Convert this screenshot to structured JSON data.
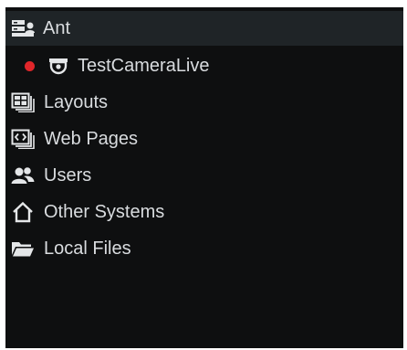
{
  "tree": {
    "server": {
      "label": "Ant",
      "icon": "server-icon"
    },
    "camera": {
      "label": "TestCameraLive",
      "icon": "camera-icon",
      "status_color": "#e0262a"
    },
    "layouts": {
      "label": "Layouts",
      "icon": "layouts-icon"
    },
    "web_pages": {
      "label": "Web Pages",
      "icon": "web-pages-icon"
    },
    "users": {
      "label": "Users",
      "icon": "users-icon"
    },
    "other_systems": {
      "label": "Other Systems",
      "icon": "home-icon"
    },
    "local_files": {
      "label": "Local Files",
      "icon": "folder-icon"
    }
  },
  "colors": {
    "panel_bg": "#0e0f10",
    "selected_bg": "#1f2427",
    "text": "#d9dcdf",
    "icon": "#e4e6e8",
    "status_red": "#e0262a"
  }
}
